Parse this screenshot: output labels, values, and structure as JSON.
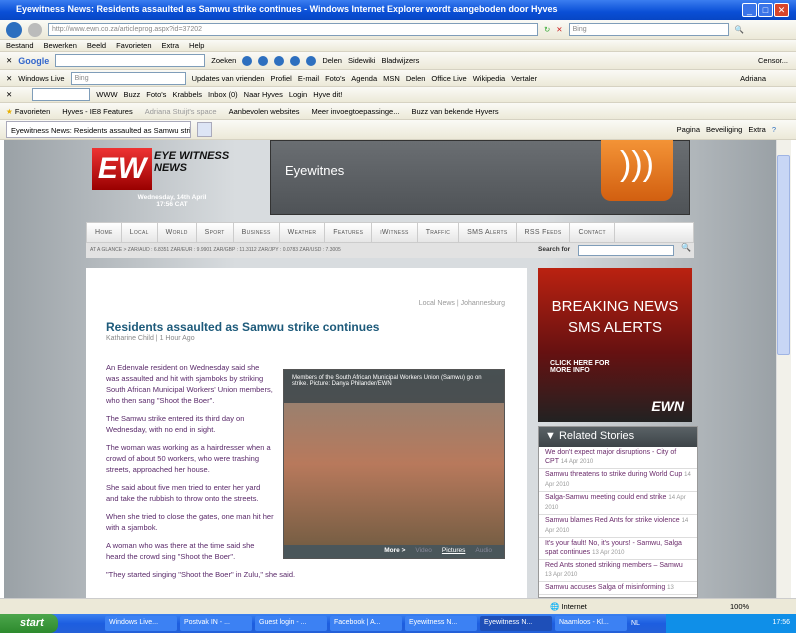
{
  "window": {
    "title": "Eyewitness News: Residents assaulted as Samwu strike continues - Windows Internet Explorer wordt aangeboden door Hyves"
  },
  "address": {
    "url": "http://www.ewn.co.za/articleprog.aspx?id=37202",
    "search_placeholder": "Bing"
  },
  "menu": [
    "Bestand",
    "Bewerken",
    "Beeld",
    "Favorieten",
    "Extra",
    "Help"
  ],
  "google_toolbar": {
    "brand": "Google",
    "search": "Zoeken",
    "share": "Delen",
    "sidewiki": "Sidewiki",
    "bookmarks": "Bladwijzers",
    "censor": "Censor..."
  },
  "live_toolbar": {
    "brand": "Windows Live",
    "placeholder": "Bing",
    "links": [
      "Updates van vrienden",
      "Profiel",
      "E-mail",
      "Foto's",
      "Agenda",
      "MSN",
      "Delen"
    ],
    "office": "Office Live",
    "wikipedia": "Wikipedia",
    "translate": "Vertaler",
    "user": "Adriana"
  },
  "hyves_toolbar": {
    "links": [
      "WWW",
      "Buzz",
      "Foto's",
      "Krabbels",
      "Inbox (0)",
      "Naar Hyves",
      "Login",
      "Hyve dit!"
    ]
  },
  "favorites": {
    "label": "Favorieten",
    "items": [
      "Hyves - IE8 Features",
      "Adriana Stuijt's space",
      "Aanbevolen websites",
      "Meer invoegtoepassinge...",
      "Buzz van bekende Hyvers"
    ]
  },
  "tab": {
    "label": "Eyewitness News: Residents assaulted as Samwu stri...",
    "commands": [
      "Pagina",
      "Beveiliging",
      "Extra"
    ]
  },
  "site": {
    "logo": "EYE WITNESS NEWS",
    "date": "Wednesday, 14th April",
    "time": "17:56 CAT",
    "banner_text": "Eyewitnes",
    "nav": [
      "Home",
      "Local",
      "World",
      "Sport",
      "Business",
      "Weather",
      "Features",
      "iWitness",
      "Traffic",
      "SMS Alerts",
      "RSS Feeds",
      "Contact"
    ],
    "rates": "AT A GLANCE >   ZAR/AUD : 6.8351   ZAR/EUR : 9.9901   ZAR/GBP : 11.3112   ZAR/JPY : 0.0783   ZAR/USD : 7.3005",
    "search_label": "Search for"
  },
  "article": {
    "section": "Local News | Johannesburg",
    "headline": "Residents assaulted as Samwu strike continues",
    "byline": "Katharine Child | 1 Hour Ago",
    "paragraphs": [
      "An Edenvale resident on Wednesday said she was assaulted and hit with sjamboks by striking South African Municipal Workers' Union members, who then sang \"Shoot the Boer\".",
      "The Samwu strike entered its third day on Wednesday, with no end in sight.",
      "The woman was working as a hairdresser when a crowd of about 50 workers, who were trashing streets, approached her house.",
      "She said about five men tried to enter her yard and take the rubbish to throw onto the streets.",
      "When she tried to close the gates, one man hit her with a sjambok.",
      "A woman who was there at the time said she heard the crowd sing \"Shoot the Boer\".",
      "\"They started singing \"Shoot the Boer\" in Zulu,\" she said."
    ],
    "photo_caption": "Members of the South African Municipal Workers Union (Samwu) go on strike. Picture: Danya Philander/EWN",
    "media_tabs": [
      "More >",
      "Video",
      "Pictures",
      "Audio"
    ]
  },
  "ad": {
    "line1": "BREAKING NEWS",
    "line2": "SMS ALERTS",
    "cta": "CLICK HERE FOR MORE INFO",
    "logo": "EWN"
  },
  "related": {
    "title": "Related Stories",
    "items": [
      {
        "t": "We don't expect major disruptions - City of CPT",
        "d": "14 Apr 2010"
      },
      {
        "t": "Samwu threatens to strike during World Cup",
        "d": "14 Apr 2010"
      },
      {
        "t": "Salga-Samwu meeting could end strike",
        "d": "14 Apr 2010"
      },
      {
        "t": "Samwu blames Red Ants for strike violence",
        "d": "14 Apr 2010"
      },
      {
        "t": "It's your fault! No, it's yours! - Samwu, Salga spat continues",
        "d": "13 Apr 2010"
      },
      {
        "t": "Red Ants stoned striking members – Samwu",
        "d": "13 Apr 2010"
      },
      {
        "t": "Samwu accuses Salga of misinforming",
        "d": "13"
      }
    ]
  },
  "statusbar": {
    "zone": "Internet",
    "zoom": "100%"
  },
  "taskbar": {
    "start": "start",
    "tasks": [
      "Windows Live...",
      "Postvak IN - ...",
      "Guest login - ...",
      "Facebook | A...",
      "Eyewitness N...",
      "Eyewitness N...",
      "Naamloos - Kl..."
    ],
    "lang": "NL",
    "clock": "17:56"
  }
}
